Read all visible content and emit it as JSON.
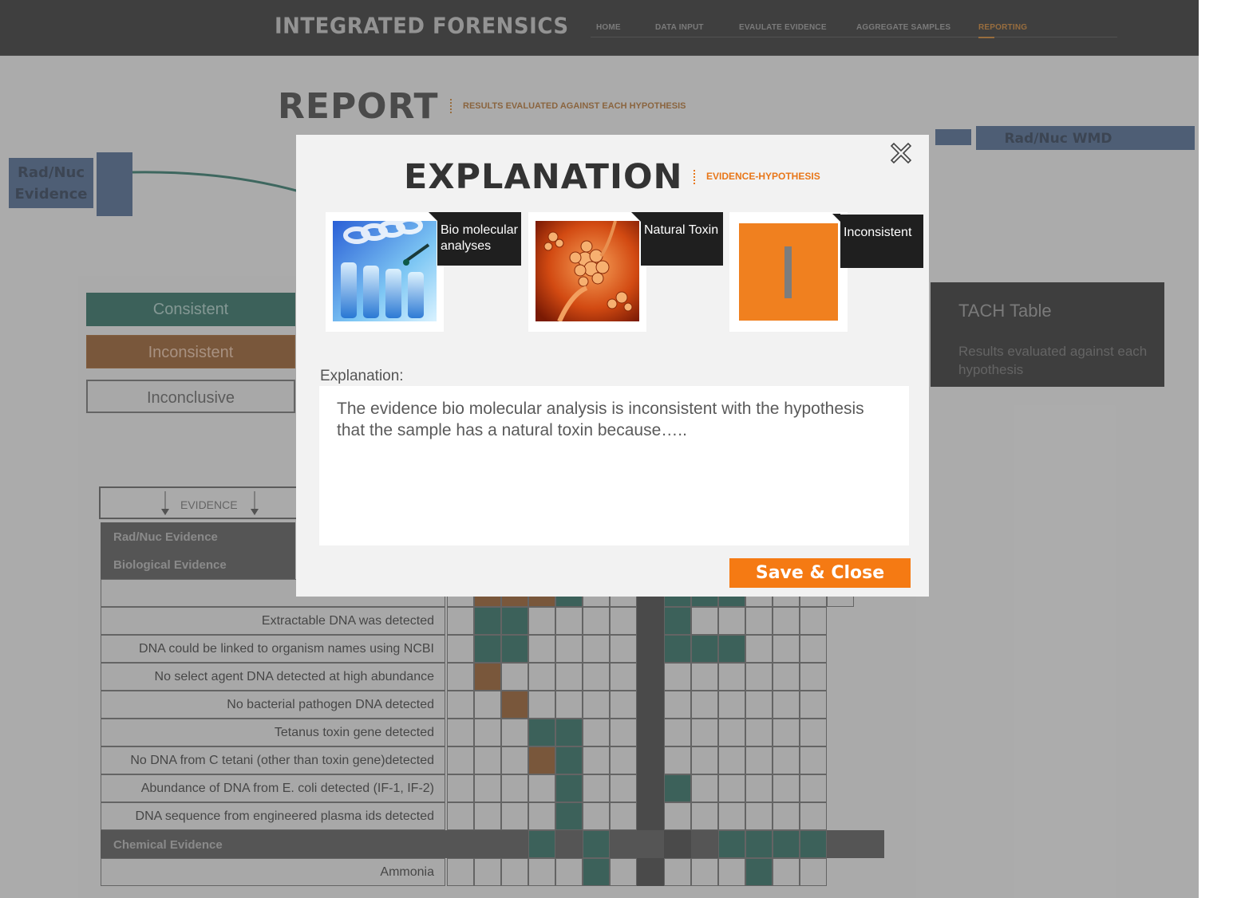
{
  "header": {
    "brand": "INTEGRATED FORENSICS",
    "nav": [
      {
        "label": "HOME"
      },
      {
        "label": "DATA INPUT"
      },
      {
        "label": "EVAULATE EVIDENCE"
      },
      {
        "label": "AGGREGATE SAMPLES"
      },
      {
        "label": "REPORTING",
        "active": true
      }
    ]
  },
  "report": {
    "title": "REPORT",
    "subtitle": "RESULTS EVALUATED AGAINST EACH HYPOTHESIS"
  },
  "diagram": {
    "left_label_line1": "Rad/Nuc",
    "left_label_line2": "Evidence",
    "right_label": "Rad/Nuc WMD"
  },
  "legend": {
    "consistent": "Consistent",
    "inconsistent": "Inconsistent",
    "inconclusive": "Inconclusive"
  },
  "table": {
    "evidence_header": "EVIDENCE",
    "groups": [
      "Rad/Nuc Evidence",
      "Biological  Evidence",
      "Chemical  Evidence"
    ],
    "rows": [
      {
        "label": "Extractable  DNA was detected",
        "cells": [
          "",
          "c",
          "c",
          "",
          "",
          "",
          "",
          "bar",
          "c",
          "",
          "",
          "",
          "",
          ""
        ]
      },
      {
        "label": "DNA could be linked to organism names using NCBI",
        "cells": [
          "",
          "c",
          "c",
          "",
          "",
          "",
          "",
          "bar",
          "c",
          "c",
          "c",
          "",
          "",
          ""
        ]
      },
      {
        "label": "No select agent DNA detected at high abundance",
        "cells": [
          "",
          "i",
          "",
          "",
          "",
          "",
          "",
          "bar",
          "",
          "",
          "",
          "",
          "",
          ""
        ]
      },
      {
        "label": "No bacterial pathogen  DNA detected",
        "cells": [
          "",
          "",
          "i",
          "",
          "",
          "",
          "",
          "bar",
          "",
          "",
          "",
          "",
          "",
          ""
        ]
      },
      {
        "label": "Tetanus  toxin gene detected",
        "cells": [
          "",
          "",
          "",
          "c",
          "c",
          "",
          "",
          "bar",
          "",
          "",
          "",
          "",
          "",
          ""
        ]
      },
      {
        "label": "No DNA from C tetani  (other than toxin gene)detected",
        "cells": [
          "",
          "",
          "",
          "i",
          "c",
          "",
          "",
          "bar",
          "",
          "",
          "",
          "",
          "",
          ""
        ]
      },
      {
        "label": "Abundance of DNA from E. coli detected  (IF-1, IF-2)",
        "cells": [
          "",
          "",
          "",
          "",
          "c",
          "",
          "",
          "bar",
          "c",
          "",
          "",
          "",
          "",
          ""
        ]
      },
      {
        "label": "DNA sequence from engineered plasma  ids detected",
        "cells": [
          "",
          "",
          "",
          "",
          "c",
          "",
          "",
          "bar",
          "",
          "",
          "",
          "",
          "",
          ""
        ]
      },
      {
        "label": "Ammonia",
        "cells": [
          "",
          "",
          "",
          "",
          "",
          "c",
          "",
          "bar",
          "",
          "",
          "",
          "c",
          "",
          ""
        ]
      }
    ],
    "chemical_group_cells": [
      "",
      "",
      "",
      "",
      "c",
      "",
      "c",
      "",
      "",
      "",
      "",
      "c",
      "c",
      "c",
      "c"
    ]
  },
  "info_box": {
    "title": "TACH Table",
    "description": "Results evaluated against each hypothesis"
  },
  "modal": {
    "title": "EXPLANATION",
    "subtitle": "EVIDENCE-HYPOTHESIS",
    "cards": [
      {
        "label": "Bio molecular analyses",
        "icon": "lab-sample-image"
      },
      {
        "label": "Natural Toxin",
        "icon": "toxin-microbe-image"
      },
      {
        "label": "Inconsistent",
        "icon": "inconsistent-status-image"
      }
    ],
    "explanation_label": "Explanation:",
    "explanation_text": "The evidence bio molecular analysis is inconsistent with the hypothesis that the sample has a natural toxin because…..",
    "save_label": "Save & Close"
  },
  "colors": {
    "accent": "#f57a13",
    "consistent": "#0c4f43",
    "inconsistent": "#7a3d0a",
    "header_bg": "#121212"
  }
}
